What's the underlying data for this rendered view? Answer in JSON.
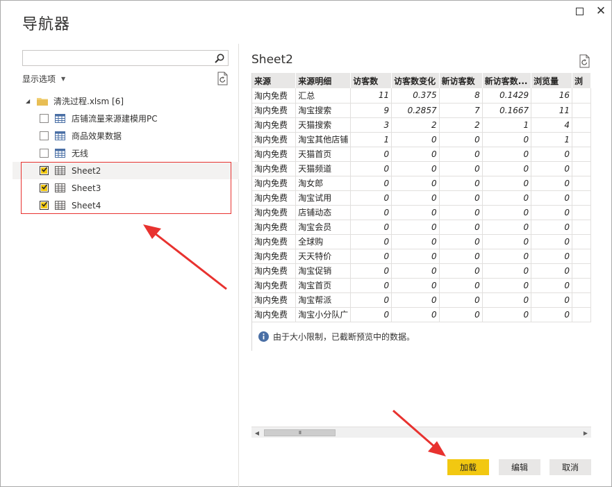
{
  "window": {
    "title": "导航器",
    "maximize_icon": "maximize-icon",
    "close_icon": "close-icon",
    "close_glyph": "✕"
  },
  "navigator": {
    "search": {
      "value": "",
      "placeholder": ""
    },
    "display_options_label": "显示选项",
    "tree": {
      "root": {
        "label": "清洗过程.xlsm [6]",
        "expanded": true
      },
      "items": [
        {
          "label": "店铺流量来源建模用PC",
          "checked": false,
          "type": "table"
        },
        {
          "label": "商品效果数据",
          "checked": false,
          "type": "table"
        },
        {
          "label": "无线",
          "checked": false,
          "type": "table"
        },
        {
          "label": "Sheet2",
          "checked": true,
          "type": "sheet",
          "selected": true
        },
        {
          "label": "Sheet3",
          "checked": true,
          "type": "sheet"
        },
        {
          "label": "Sheet4",
          "checked": true,
          "type": "sheet"
        }
      ]
    }
  },
  "preview": {
    "title": "Sheet2",
    "columns": [
      "来源",
      "来源明细",
      "访客数",
      "访客数变化",
      "新访客数",
      "新访客数...",
      "浏览量",
      "浏"
    ],
    "rows": [
      [
        "淘内免费",
        "汇总",
        "11",
        "0.375",
        "8",
        "0.1429",
        "16",
        ""
      ],
      [
        "淘内免费",
        "淘宝搜索",
        "9",
        "0.2857",
        "7",
        "0.1667",
        "11",
        ""
      ],
      [
        "淘内免费",
        "天猫搜索",
        "3",
        "2",
        "2",
        "1",
        "4",
        ""
      ],
      [
        "淘内免费",
        "淘宝其他店铺",
        "1",
        "0",
        "0",
        "0",
        "1",
        ""
      ],
      [
        "淘内免费",
        "天猫首页",
        "0",
        "0",
        "0",
        "0",
        "0",
        ""
      ],
      [
        "淘内免费",
        "天猫频道",
        "0",
        "0",
        "0",
        "0",
        "0",
        ""
      ],
      [
        "淘内免费",
        "淘女郎",
        "0",
        "0",
        "0",
        "0",
        "0",
        ""
      ],
      [
        "淘内免费",
        "淘宝试用",
        "0",
        "0",
        "0",
        "0",
        "0",
        ""
      ],
      [
        "淘内免费",
        "店铺动态",
        "0",
        "0",
        "0",
        "0",
        "0",
        ""
      ],
      [
        "淘内免费",
        "淘宝会员",
        "0",
        "0",
        "0",
        "0",
        "0",
        ""
      ],
      [
        "淘内免费",
        "全球购",
        "0",
        "0",
        "0",
        "0",
        "0",
        ""
      ],
      [
        "淘内免费",
        "天天特价",
        "0",
        "0",
        "0",
        "0",
        "0",
        ""
      ],
      [
        "淘内免费",
        "淘宝促销",
        "0",
        "0",
        "0",
        "0",
        "0",
        ""
      ],
      [
        "淘内免费",
        "淘宝首页",
        "0",
        "0",
        "0",
        "0",
        "0",
        ""
      ],
      [
        "淘内免费",
        "淘宝帮派",
        "0",
        "0",
        "0",
        "0",
        "0",
        ""
      ],
      [
        "淘内免费",
        "淘宝小分队广",
        "0",
        "0",
        "0",
        "0",
        "0",
        ""
      ]
    ],
    "info_text": "由于大小限制，已截断预览中的数据。",
    "scroll_thumb_glyph": "III"
  },
  "buttons": {
    "load": "加载",
    "edit": "编辑",
    "cancel": "取消"
  },
  "colors": {
    "accent_yellow": "#f2c811",
    "annotation_red": "#e8322f",
    "header_gray": "#e8e7e6"
  }
}
